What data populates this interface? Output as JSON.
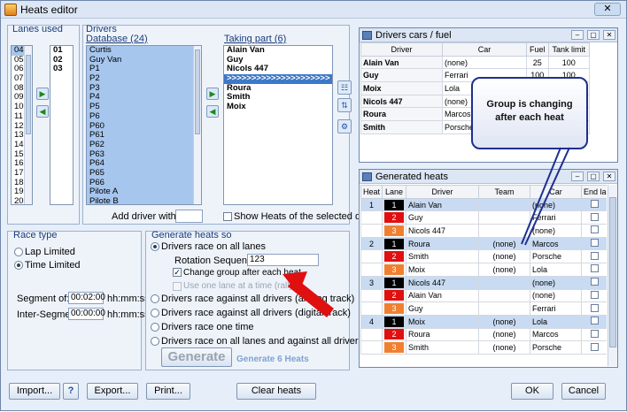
{
  "window": {
    "title": "Heats editor"
  },
  "lanes": {
    "label": "Lanes used",
    "available": [
      "04",
      "05",
      "06",
      "07",
      "08",
      "09",
      "10",
      "11",
      "12",
      "13",
      "14",
      "15",
      "16",
      "17",
      "18",
      "19",
      "20"
    ],
    "used": [
      "01",
      "02",
      "03"
    ]
  },
  "drivers": {
    "label": "Drivers",
    "database_label": "Database (24)",
    "database": [
      "Curtis",
      "Guy Van",
      "P1",
      "P2",
      "P3",
      "P4",
      "P5",
      "P6",
      "P60",
      "P61",
      "P62",
      "P63",
      "P64",
      "P65",
      "P66",
      "Pilote A",
      "Pilote B"
    ],
    "taking_part_label": "Taking part (6)",
    "taking_part": [
      "Alain Van",
      "Guy",
      "Nicols 447",
      ">>>>>>>>>>>>>>>>>>>>>",
      "Roura",
      "Smith",
      "Moix"
    ],
    "add_driver_label": "Add driver with ID:",
    "show_heats_label": "Show Heats of the selected driver"
  },
  "race_type": {
    "label": "Race type",
    "lap_limited": "Lap Limited",
    "time_limited": "Time Limited",
    "segment_label": "Segment of:",
    "segment_value": "00:02:00",
    "inter_segment_label": "Inter-Segment:",
    "inter_segment_value": "00:00:00",
    "unit": "hh:mm:ss"
  },
  "generate": {
    "label": "Generate heats so",
    "opt_all_lanes": "Drivers race on all lanes",
    "rotation_label": "Rotation Sequence:",
    "rotation_value": "123",
    "change_group": "Change group after each heat",
    "one_lane": "Use one lane at a time (rally)",
    "opt_analog": "Drivers race against all drivers (analog track)",
    "opt_digital": "Drivers race against all drivers (digital track)",
    "opt_one_time": "Drivers race one time",
    "opt_all_lanes_all_drivers": "Drivers race on all lanes and against all drivers",
    "button": "Generate",
    "count_label": "Generate 6 Heats"
  },
  "cars_fuel": {
    "title": "Drivers cars / fuel",
    "columns": [
      "Driver",
      "Car",
      "Fuel",
      "Tank limit"
    ],
    "rows": [
      [
        "Alain Van",
        "(none)",
        "25",
        "100"
      ],
      [
        "Guy",
        "Ferrari",
        "100",
        "100"
      ],
      [
        "Moix",
        "Lola",
        "",
        ""
      ],
      [
        "Nicols 447",
        "(none)",
        "",
        ""
      ],
      [
        "Roura",
        "Marcos",
        "",
        ""
      ],
      [
        "Smith",
        "Porsche",
        "",
        ""
      ]
    ]
  },
  "heats": {
    "title": "Generated heats",
    "columns": [
      "Heat",
      "Lane",
      "Driver",
      "Team",
      "Car",
      "End lap"
    ],
    "lane_colors": {
      "1": "#000000",
      "2": "#e01010",
      "3": "#f08030"
    },
    "rows": [
      {
        "heat": "1",
        "lane": "1",
        "driver": "Alain Van",
        "team": "",
        "car": "(none)"
      },
      {
        "heat": "",
        "lane": "2",
        "driver": "Guy",
        "team": "",
        "car": "Ferrari"
      },
      {
        "heat": "",
        "lane": "3",
        "driver": "Nicols 447",
        "team": "",
        "car": "(none)"
      },
      {
        "heat": "2",
        "lane": "1",
        "driver": "Roura",
        "team": "(none)",
        "car": "Marcos"
      },
      {
        "heat": "",
        "lane": "2",
        "driver": "Smith",
        "team": "(none)",
        "car": "Porsche"
      },
      {
        "heat": "",
        "lane": "3",
        "driver": "Moix",
        "team": "(none)",
        "car": "Lola"
      },
      {
        "heat": "3",
        "lane": "1",
        "driver": "Nicols 447",
        "team": "",
        "car": "(none)"
      },
      {
        "heat": "",
        "lane": "2",
        "driver": "Alain Van",
        "team": "",
        "car": "(none)"
      },
      {
        "heat": "",
        "lane": "3",
        "driver": "Guy",
        "team": "",
        "car": "Ferrari"
      },
      {
        "heat": "4",
        "lane": "1",
        "driver": "Moix",
        "team": "(none)",
        "car": "Lola"
      },
      {
        "heat": "",
        "lane": "2",
        "driver": "Roura",
        "team": "(none)",
        "car": "Marcos"
      },
      {
        "heat": "",
        "lane": "3",
        "driver": "Smith",
        "team": "(none)",
        "car": "Porsche"
      }
    ]
  },
  "annotations": {
    "callout_line1": "Group is changing",
    "callout_line2": "after each heat"
  },
  "buttons": {
    "import": "Import...",
    "export": "Export...",
    "print": "Print...",
    "clear_heats": "Clear heats",
    "ok": "OK",
    "cancel": "Cancel"
  }
}
